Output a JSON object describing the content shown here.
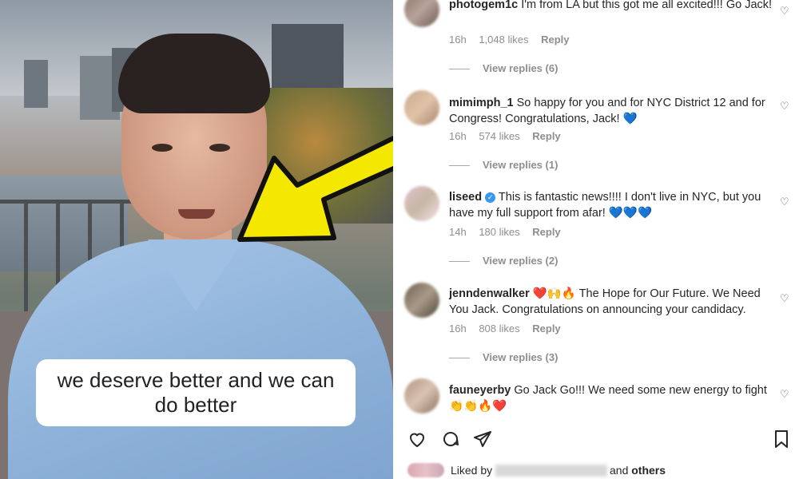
{
  "caption": "we deserve better and we can do better",
  "comments": [
    {
      "user": "photogem1c",
      "text": "I'm from LA but this got me all excited!!! Go Jack!",
      "time": "16h",
      "likes": "1,048 likes",
      "reply": "Reply",
      "replies": "View replies (6)",
      "avatar_colors": [
        "#8d7466",
        "#b7a39a",
        "#6f5a50"
      ]
    },
    {
      "user": "mimimph_1",
      "text": "So happy for you and for NYC District 12 and for Congress! Congratulations, Jack! 💙",
      "time": "16h",
      "likes": "574 likes",
      "reply": "Reply",
      "replies": "View replies (1)",
      "avatar_colors": [
        "#c9a98c",
        "#e1c3a8",
        "#a8876f"
      ]
    },
    {
      "user": "liseed",
      "verified": true,
      "text": "This is fantastic news!!!! I don't live in NYC, but you have my full support from afar! 💙💙💙",
      "time": "14h",
      "likes": "180 likes",
      "reply": "Reply",
      "replies": "View replies (2)",
      "avatar_colors": [
        "#e2c1c8",
        "#c7b7a6",
        "#efe1e3"
      ]
    },
    {
      "user": "jenndenwalker",
      "text": "❤️🙌🔥 The Hope for Our Future. We Need You Jack. Congratulations on announcing your candidacy.",
      "time": "16h",
      "likes": "808 likes",
      "reply": "Reply",
      "replies": "View replies (3)",
      "avatar_colors": [
        "#6e6152",
        "#a89a86",
        "#4f473e"
      ]
    },
    {
      "user": "fauneyerby",
      "text": "Go Jack Go!!! We need some new energy to fight 👏👏🔥❤️",
      "avatar_colors": [
        "#b39580",
        "#d8c3b2",
        "#8d735f"
      ]
    }
  ],
  "actions": {
    "like": "heart-outline-icon",
    "comment": "comment-bubble-icon",
    "share": "paper-plane-icon",
    "save": "bookmark-icon"
  },
  "liked_by": {
    "prefix": "Liked by",
    "suffix": "and others"
  },
  "colors": {
    "arrow": "#f5e800",
    "arrow_outline": "#111111",
    "text": "#262626",
    "muted": "#8e8e8e"
  }
}
